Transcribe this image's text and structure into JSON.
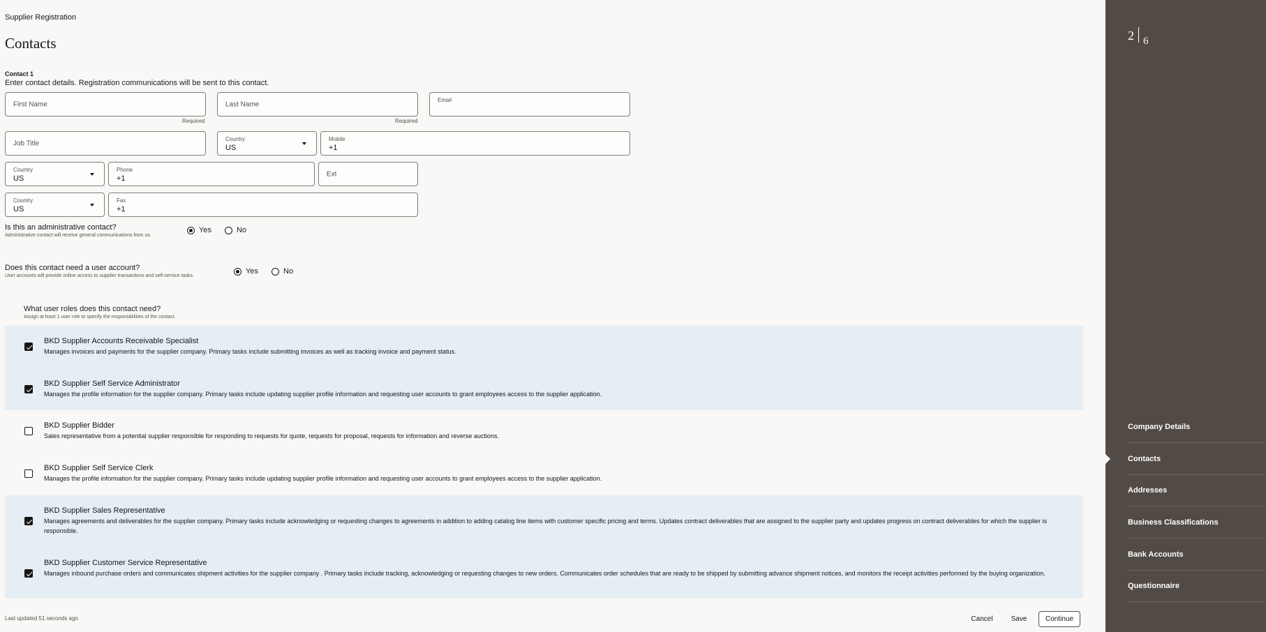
{
  "app_title": "Supplier Registration",
  "page_title": "Contacts",
  "contact": {
    "label": "Contact 1",
    "description": "Enter contact details. Registration communications will be sent to this contact.",
    "first_name": {
      "label": "First Name",
      "value": "",
      "hint": "Required"
    },
    "last_name": {
      "label": "Last Name",
      "value": "",
      "hint": "Required"
    },
    "email": {
      "label": "Email",
      "value": ""
    },
    "job_title": {
      "label": "Job Title",
      "value": ""
    },
    "mobile_country": {
      "label": "Country",
      "value": "US"
    },
    "mobile": {
      "label": "Mobile",
      "value": "+1"
    },
    "phone_country": {
      "label": "Country",
      "value": "US"
    },
    "phone": {
      "label": "Phone",
      "value": "+1"
    },
    "ext": {
      "label": "Ext",
      "value": ""
    },
    "fax_country": {
      "label": "Country",
      "value": "US"
    },
    "fax": {
      "label": "Fax",
      "value": "+1"
    }
  },
  "admin_question": {
    "question": "Is this an administrative contact?",
    "sub": "Administrative contact will receive general communications from us.",
    "yes": "Yes",
    "no": "No",
    "selected": "Yes"
  },
  "account_question": {
    "question": "Does this contact need a user account?",
    "sub": "User accounts will provide online access to supplier transactions and self-service tasks.",
    "yes": "Yes",
    "no": "No",
    "selected": "Yes"
  },
  "roles": {
    "title": "What user roles does this contact need?",
    "sub": "Assign at least 1 user role to specify the responsibilities of the contact.",
    "items": [
      {
        "name": "BKD Supplier Accounts Receivable Specialist",
        "description": "Manages invoices and payments for the supplier company. Primary tasks include submitting invoices as well as tracking invoice and payment status.",
        "checked": true
      },
      {
        "name": "BKD Supplier Self Service Administrator",
        "description": "Manages the profile information for the supplier company. Primary tasks include updating supplier profile information and requesting user accounts to grant employees access to the supplier application.",
        "checked": true
      },
      {
        "name": "BKD Supplier Bidder",
        "description": "Sales representative from a potential supplier responsible for responding to requests for quote, requests for proposal, requests for information and reverse auctions.",
        "checked": false
      },
      {
        "name": "BKD Supplier Self Service Clerk",
        "description": "Manages the profile information for the supplier company. Primary tasks include updating supplier profile information and requesting user accounts to grant employees access to the supplier application.",
        "checked": false
      },
      {
        "name": "BKD Supplier Sales Representative",
        "description": "Manages agreements and deliverables for the supplier company. Primary tasks include acknowledging or requesting changes to agreements in addition to adding catalog line items with customer specific pricing and terms. Updates contract deliverables that are assigned to the supplier party and updates progress on contract deliverables for which the supplier is responsible.",
        "checked": true
      },
      {
        "name": "BKD Supplier Customer Service Representative",
        "description": "Manages inbound purchase orders and communicates shipment activities for the supplier company . Primary tasks include tracking, acknowledging or requesting changes to new orders. Communicates order schedules that are ready to be shipped by submitting advance shipment notices, and monitors the receipt activities performed by the buying organization.",
        "checked": true
      }
    ]
  },
  "footer": {
    "status": "Last updated 51 seconds ago",
    "cancel": "Cancel",
    "save": "Save",
    "continue": "Continue"
  },
  "sidebar": {
    "current_step": "2",
    "total_steps": "6",
    "active": "Contacts",
    "items": [
      {
        "label": "Company Details"
      },
      {
        "label": "Contacts"
      },
      {
        "label": "Addresses"
      },
      {
        "label": "Business Classifications"
      },
      {
        "label": "Bank Accounts"
      },
      {
        "label": "Questionnaire"
      }
    ]
  }
}
